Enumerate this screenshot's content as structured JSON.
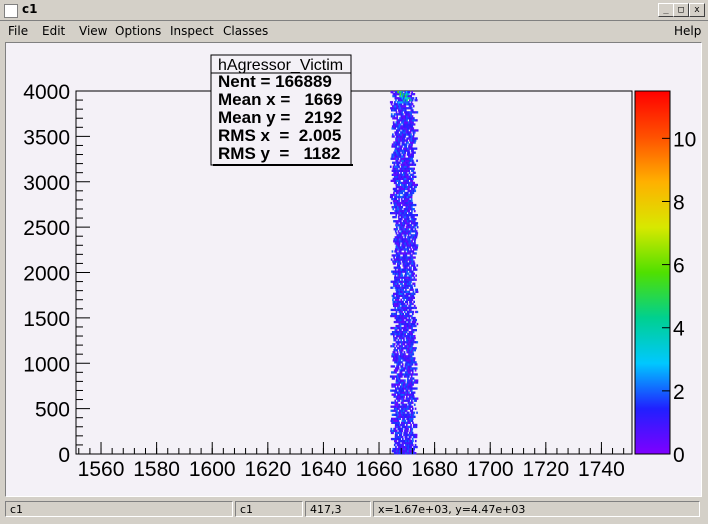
{
  "window": {
    "title": "c1",
    "minimize_glyph": "_",
    "maximize_glyph": "□",
    "close_glyph": "x"
  },
  "menu": {
    "items": [
      "File",
      "Edit",
      "View",
      "Options",
      "Inspect",
      "Classes"
    ],
    "help": "Help"
  },
  "stats": {
    "name": "hAgressor_Victim",
    "lines": [
      "Nent = 166889",
      "Mean x =   1669",
      "Mean y =   2192",
      "RMS x  =  2.005",
      "RMS y  =   1182"
    ]
  },
  "status": {
    "cells": [
      "c1",
      "c1",
      "417,3",
      "x=1.67e+03, y=4.47e+03"
    ]
  },
  "chart_data": {
    "type": "heatmap",
    "title": "",
    "xlabel": "",
    "ylabel": "",
    "x_ticks": [
      1560,
      1580,
      1600,
      1620,
      1640,
      1660,
      1680,
      1700,
      1720,
      1740
    ],
    "x_tick_labels": [
      "1560",
      "1580",
      "1600",
      "1620",
      "1640",
      "1660",
      "1680",
      "1700",
      "1720",
      "1740"
    ],
    "y_ticks": [
      0,
      500,
      1000,
      1500,
      2000,
      2500,
      3000,
      3500,
      4000
    ],
    "y_tick_labels": [
      "0",
      "500",
      "1000",
      "1500",
      "2000",
      "2500",
      "3000",
      "3500",
      "4000"
    ],
    "xlim": [
      1551,
      1751
    ],
    "ylim": [
      0,
      4000
    ],
    "zlim": [
      0,
      11.5
    ],
    "z_ticks": [
      0,
      2,
      4,
      6,
      8,
      10
    ],
    "z_tick_labels": [
      "0",
      "2",
      "4",
      "6",
      "8",
      "10"
    ],
    "colormap": [
      "#7f00ff",
      "#2020ff",
      "#00c8ff",
      "#00d090",
      "#50e000",
      "#d8e800",
      "#ffb000",
      "#ff5000",
      "#ff0000"
    ],
    "band": {
      "x_center_start": 1669,
      "x_center_end": 1669,
      "x_halfwidth": 4,
      "y_range": [
        0,
        4000
      ],
      "peak_near_y": 3950
    },
    "grid": false
  }
}
